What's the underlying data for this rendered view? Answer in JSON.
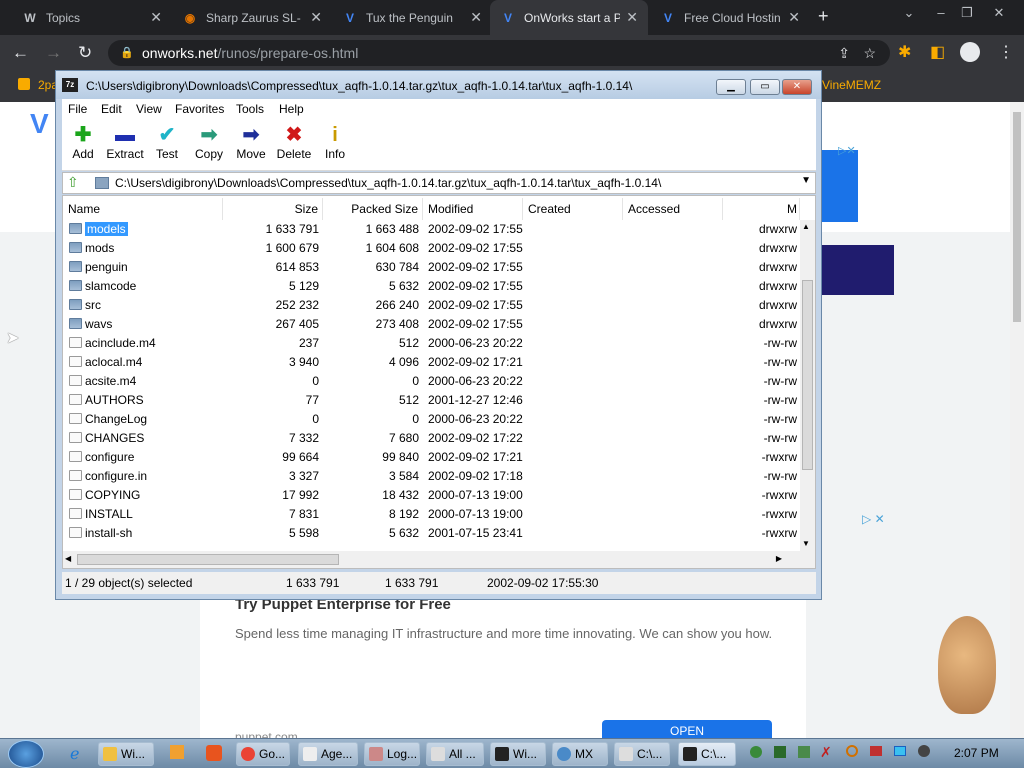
{
  "browser": {
    "tabs": [
      {
        "label": "Topics",
        "favicon": "W",
        "color": "#bdc1c6",
        "active": false
      },
      {
        "label": "Sharp Zaurus SL-",
        "favicon": "S",
        "color": "#e37400",
        "active": false
      },
      {
        "label": "Tux the Penguin",
        "favicon": "V",
        "color": "#4285f4",
        "active": false
      },
      {
        "label": "OnWorks start a P",
        "favicon": "V",
        "color": "#4285f4",
        "active": true
      },
      {
        "label": "Free Cloud Hostin",
        "favicon": "V",
        "color": "#4285f4",
        "active": false
      }
    ],
    "new_tab": "+",
    "url_domain": "onworks.net",
    "url_path": "/runos/prepare-os.html",
    "bookmarks": {
      "left": "2pa",
      "right": "VineMEMZ"
    }
  },
  "webpage": {
    "ad_title": "Try Puppet Enterprise for Free",
    "ad_body": "Spend less time managing IT infrastructure and more time innovating. We can show you how.",
    "ad_domain": "puppet.com",
    "ad_button": "OPEN"
  },
  "zip": {
    "title": "C:\\Users\\digibrony\\Downloads\\Compressed\\tux_aqfh-1.0.14.tar.gz\\tux_aqfh-1.0.14.tar\\tux_aqfh-1.0.14\\",
    "menu": [
      "File",
      "Edit",
      "View",
      "Favorites",
      "Tools",
      "Help"
    ],
    "tools": [
      {
        "label": "Add",
        "icon": "add-icon",
        "glyph": "✚",
        "color": "#1aa51a"
      },
      {
        "label": "Extract",
        "icon": "extract-icon",
        "glyph": "▬",
        "color": "#1f2fb0"
      },
      {
        "label": "Test",
        "icon": "test-icon",
        "glyph": "✔",
        "color": "#1fb4c8"
      },
      {
        "label": "Copy",
        "icon": "copy-icon",
        "glyph": "➡",
        "color": "#2a9a7a"
      },
      {
        "label": "Move",
        "icon": "move-icon",
        "glyph": "➡",
        "color": "#1f2f9a"
      },
      {
        "label": "Delete",
        "icon": "delete-icon",
        "glyph": "✖",
        "color": "#d01818"
      },
      {
        "label": "Info",
        "icon": "info-icon",
        "glyph": "i",
        "color": "#c99a00"
      }
    ],
    "address": "C:\\Users\\digibrony\\Downloads\\Compressed\\tux_aqfh-1.0.14.tar.gz\\tux_aqfh-1.0.14.tar\\tux_aqfh-1.0.14\\",
    "columns": [
      "Name",
      "Size",
      "Packed Size",
      "Modified",
      "Created",
      "Accessed",
      "M"
    ],
    "rows": [
      {
        "name": "models",
        "size": "1 633 791",
        "packed": "1 663 488",
        "modified": "2002-09-02 17:55",
        "mode": "drwxrw",
        "dir": true,
        "selected": true
      },
      {
        "name": "mods",
        "size": "1 600 679",
        "packed": "1 604 608",
        "modified": "2002-09-02 17:55",
        "mode": "drwxrw",
        "dir": true
      },
      {
        "name": "penguin",
        "size": "614 853",
        "packed": "630 784",
        "modified": "2002-09-02 17:55",
        "mode": "drwxrw",
        "dir": true
      },
      {
        "name": "slamcode",
        "size": "5 129",
        "packed": "5 632",
        "modified": "2002-09-02 17:55",
        "mode": "drwxrw",
        "dir": true
      },
      {
        "name": "src",
        "size": "252 232",
        "packed": "266 240",
        "modified": "2002-09-02 17:55",
        "mode": "drwxrw",
        "dir": true
      },
      {
        "name": "wavs",
        "size": "267 405",
        "packed": "273 408",
        "modified": "2002-09-02 17:55",
        "mode": "drwxrw",
        "dir": true
      },
      {
        "name": "acinclude.m4",
        "size": "237",
        "packed": "512",
        "modified": "2000-06-23 20:22",
        "mode": "-rw-rw"
      },
      {
        "name": "aclocal.m4",
        "size": "3 940",
        "packed": "4 096",
        "modified": "2002-09-02 17:21",
        "mode": "-rw-rw"
      },
      {
        "name": "acsite.m4",
        "size": "0",
        "packed": "0",
        "modified": "2000-06-23 20:22",
        "mode": "-rw-rw"
      },
      {
        "name": "AUTHORS",
        "size": "77",
        "packed": "512",
        "modified": "2001-12-27 12:46",
        "mode": "-rw-rw"
      },
      {
        "name": "ChangeLog",
        "size": "0",
        "packed": "0",
        "modified": "2000-06-23 20:22",
        "mode": "-rw-rw"
      },
      {
        "name": "CHANGES",
        "size": "7 332",
        "packed": "7 680",
        "modified": "2002-09-02 17:22",
        "mode": "-rw-rw"
      },
      {
        "name": "configure",
        "size": "99 664",
        "packed": "99 840",
        "modified": "2002-09-02 17:21",
        "mode": "-rwxrw"
      },
      {
        "name": "configure.in",
        "size": "3 327",
        "packed": "3 584",
        "modified": "2002-09-02 17:18",
        "mode": "-rw-rw"
      },
      {
        "name": "COPYING",
        "size": "17 992",
        "packed": "18 432",
        "modified": "2000-07-13 19:00",
        "mode": "-rwxrw"
      },
      {
        "name": "INSTALL",
        "size": "7 831",
        "packed": "8 192",
        "modified": "2000-07-13 19:00",
        "mode": "-rwxrw"
      },
      {
        "name": "install-sh",
        "size": "5 598",
        "packed": "5 632",
        "modified": "2001-07-15 23:41",
        "mode": "-rwxrw"
      }
    ],
    "status": {
      "selected": "1 / 29 object(s) selected",
      "size": "1 633 791",
      "packed": "1 633 791",
      "modified": "2002-09-02 17:55:30"
    }
  },
  "taskbar": {
    "items": [
      "Wi...",
      "Go...",
      "Age...",
      "Log...",
      "All ...",
      "Wi...",
      "MX",
      "C:\\...",
      "C:\\..."
    ],
    "clock": "2:07 PM"
  }
}
